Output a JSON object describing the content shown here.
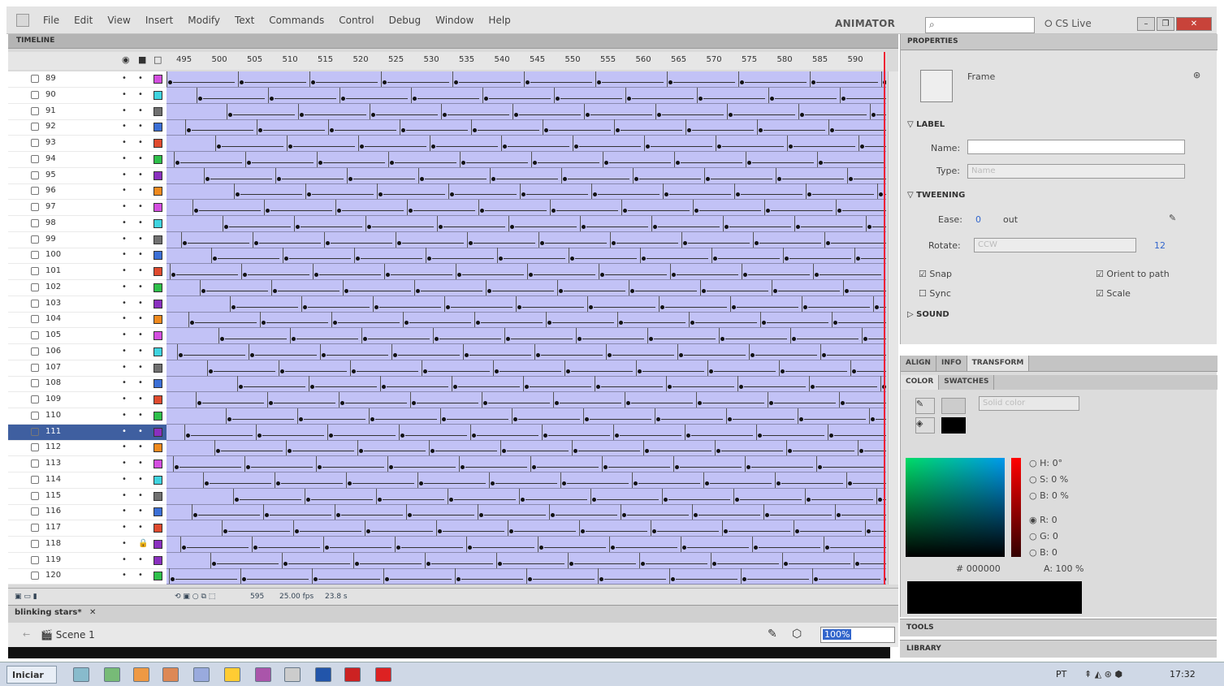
{
  "app": {
    "workspace": "ANIMATOR",
    "cs_live": "CS Live",
    "search_placeholder": ""
  },
  "menu": [
    "File",
    "Edit",
    "View",
    "Insert",
    "Modify",
    "Text",
    "Commands",
    "Control",
    "Debug",
    "Window",
    "Help"
  ],
  "timeline": {
    "title": "TIMELINE",
    "ruler": [
      "495",
      "500",
      "505",
      "510",
      "515",
      "520",
      "525",
      "530",
      "535",
      "540",
      "545",
      "550",
      "555",
      "560",
      "565",
      "570",
      "575",
      "580",
      "585",
      "590"
    ],
    "layers": [
      {
        "name": "89",
        "color": "#d44ee0",
        "lock": false
      },
      {
        "name": "90",
        "color": "#3fd4e0",
        "lock": false
      },
      {
        "name": "91",
        "color": "#707070",
        "lock": false
      },
      {
        "name": "92",
        "color": "#3b6fd6",
        "lock": false
      },
      {
        "name": "93",
        "color": "#e04a2e",
        "lock": false
      },
      {
        "name": "94",
        "color": "#2ec04a",
        "lock": false
      },
      {
        "name": "95",
        "color": "#8a2fbf",
        "lock": false
      },
      {
        "name": "96",
        "color": "#f08a1e",
        "lock": false
      },
      {
        "name": "97",
        "color": "#d44ee0",
        "lock": false
      },
      {
        "name": "98",
        "color": "#3fd4e0",
        "lock": false
      },
      {
        "name": "99",
        "color": "#707070",
        "lock": false
      },
      {
        "name": "100",
        "color": "#3b6fd6",
        "lock": false
      },
      {
        "name": "101",
        "color": "#e04a2e",
        "lock": false
      },
      {
        "name": "102",
        "color": "#2ec04a",
        "lock": false
      },
      {
        "name": "103",
        "color": "#8a2fbf",
        "lock": false
      },
      {
        "name": "104",
        "color": "#f08a1e",
        "lock": false
      },
      {
        "name": "105",
        "color": "#d44ee0",
        "lock": false
      },
      {
        "name": "106",
        "color": "#3fd4e0",
        "lock": false
      },
      {
        "name": "107",
        "color": "#707070",
        "lock": false
      },
      {
        "name": "108",
        "color": "#3b6fd6",
        "lock": false
      },
      {
        "name": "109",
        "color": "#e04a2e",
        "lock": false
      },
      {
        "name": "110",
        "color": "#2ec04a",
        "lock": false
      },
      {
        "name": "111",
        "color": "#8a2fbf",
        "lock": false,
        "selected": true
      },
      {
        "name": "112",
        "color": "#f08a1e",
        "lock": false
      },
      {
        "name": "113",
        "color": "#d44ee0",
        "lock": false
      },
      {
        "name": "114",
        "color": "#3fd4e0",
        "lock": false
      },
      {
        "name": "115",
        "color": "#707070",
        "lock": false
      },
      {
        "name": "116",
        "color": "#3b6fd6",
        "lock": false
      },
      {
        "name": "117",
        "color": "#e04a2e",
        "lock": false
      },
      {
        "name": "118",
        "color": "#8a2fbf",
        "lock": true
      },
      {
        "name": "119",
        "color": "#8a2fbf",
        "lock": false
      },
      {
        "name": "120",
        "color": "#2ec04a",
        "lock": false
      }
    ],
    "footer": {
      "frame": "595",
      "fps": "25.00 fps",
      "time": "23.8 s"
    }
  },
  "document": {
    "tab": "blinking stars*",
    "scene": "Scene 1",
    "zoom": "100%"
  },
  "properties": {
    "title": "PROPERTIES",
    "type": "Frame",
    "label_section": "LABEL",
    "name_label": "Name:",
    "type_label": "Type:",
    "type_value": "Name",
    "tweening_section": "TWEENING",
    "ease_label": "Ease:",
    "ease_value": "0",
    "ease_dir": "out",
    "rotate_label": "Rotate:",
    "rotate_value": "CCW",
    "rotate_times": "12",
    "snap": "Snap",
    "sync": "Sync",
    "orient": "Orient to path",
    "scale": "Scale",
    "sound_section": "SOUND"
  },
  "color": {
    "tabs": [
      "ALIGN",
      "INFO",
      "TRANSFORM"
    ],
    "tabs2": [
      "COLOR",
      "SWATCHES"
    ],
    "fill_type": "Solid color",
    "h": "0",
    "h_unit": "°",
    "s": "0",
    "s_unit": "%",
    "b": "0",
    "b_unit": "%",
    "r": "0",
    "g": "0",
    "bl": "0",
    "hex": "000000",
    "alpha": "100",
    "alpha_unit": "%"
  },
  "panels": {
    "tools": "TOOLS",
    "library": "LIBRARY"
  },
  "taskbar": {
    "start": "Iniciar",
    "lang": "PT",
    "time": "17:32"
  }
}
